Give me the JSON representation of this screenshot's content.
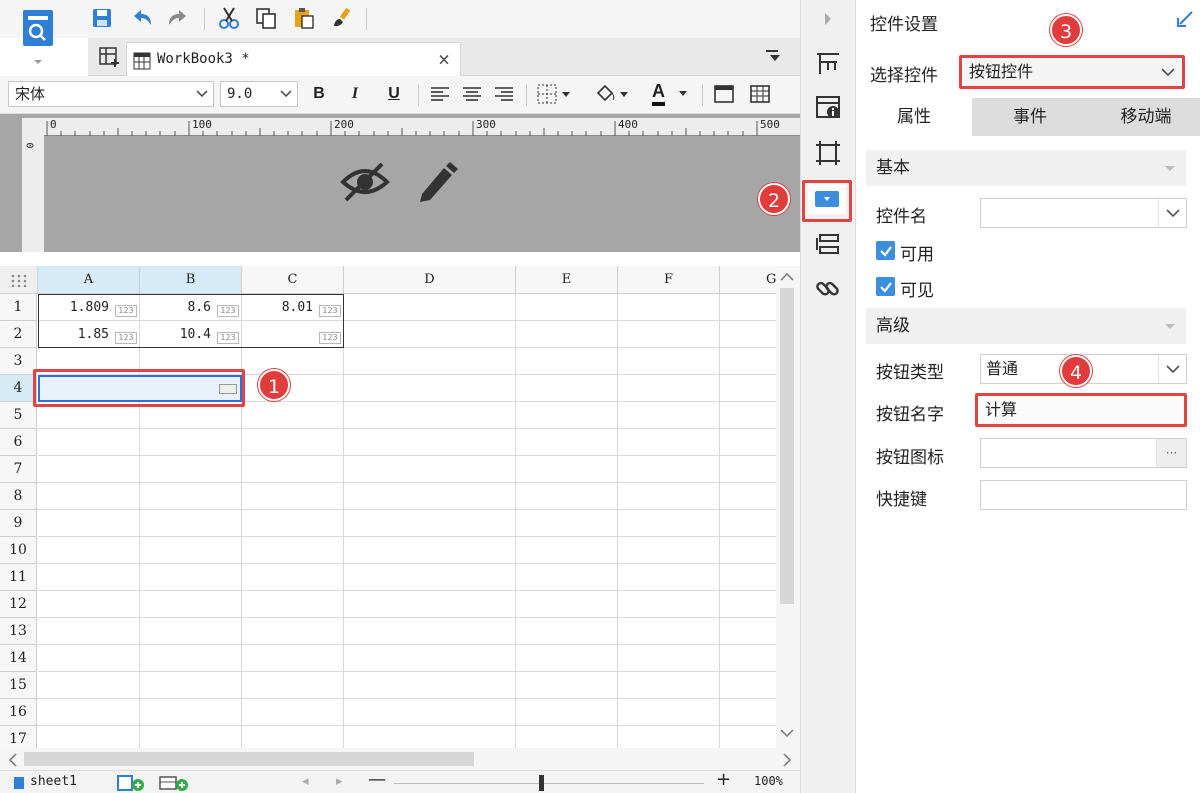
{
  "toolbar": {
    "save_icon": "save-icon",
    "undo_icon": "undo-icon",
    "redo_icon": "redo-icon",
    "cut_icon": "cut-icon",
    "copy_icon": "copy-icon",
    "paste_icon": "paste-icon",
    "format_painter_icon": "brush-icon"
  },
  "tab": {
    "label": "WorkBook3 *",
    "close": "×"
  },
  "format": {
    "font": "宋体",
    "size": "9.0",
    "bold": "B",
    "italic": "I",
    "underline": "U",
    "font_color_letter": "A"
  },
  "ruler": {
    "ticks": [
      "0",
      "100",
      "200",
      "300",
      "400",
      "500"
    ],
    "vtick": "0"
  },
  "sheet": {
    "columns": [
      "A",
      "B",
      "C",
      "D",
      "E",
      "F",
      "G"
    ],
    "rows": [
      "1",
      "2",
      "3",
      "4",
      "5",
      "6",
      "7",
      "8",
      "9",
      "10",
      "11",
      "12",
      "13",
      "14",
      "15",
      "16",
      "17"
    ],
    "cells": {
      "A1": "1.809",
      "B1": "8.6",
      "C1": "8.01",
      "A2": "1.85",
      "B2": "10.4"
    },
    "cell_badge": "123"
  },
  "status": {
    "sheet_tab": "sheet1",
    "zoom_minus": "—",
    "zoom_plus": "+",
    "zoom": "100%"
  },
  "panel": {
    "title": "控件设置",
    "select_control_label": "选择控件",
    "select_control_value": "按钮控件",
    "tabs": [
      "属性",
      "事件",
      "移动端"
    ],
    "section_basic": "基本",
    "control_name_label": "控件名",
    "control_name_value": "",
    "enabled_label": "可用",
    "visible_label": "可见",
    "section_advanced": "高级",
    "button_type_label": "按钮类型",
    "button_type_value": "普通",
    "button_name_label": "按钮名字",
    "button_name_value": "计算",
    "button_icon_label": "按钮图标",
    "button_icon_btn": "···",
    "shortcut_label": "快捷键",
    "shortcut_value": ""
  },
  "annotations": [
    "1",
    "2",
    "3",
    "4"
  ],
  "colors": {
    "accent": "#3c8fdc",
    "annotation": "#e23b3b",
    "selection": "#2f6fd6",
    "designer_bg": "#a6a6a6"
  }
}
